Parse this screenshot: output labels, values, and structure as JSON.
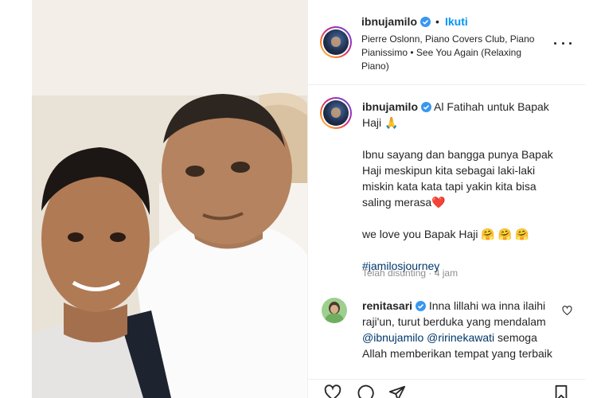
{
  "post": {
    "username": "ibnujamilo",
    "follow_label": "Ikuti",
    "separator": "•",
    "audio": "Pierre Oslonn, Piano Covers Club, Piano Pianissimo • See You Again (Relaxing Piano)",
    "caption": {
      "line1": "Al Fatihah untuk Bapak Haji 🙏",
      "line2": "Ibnu sayang dan bangga punya Bapak Haji meskipun kita sebagai laki-laki miskin kata kata tapi yakin kita bisa saling merasa❤️",
      "line3": "we love you Bapak Haji 🤗 🤗 🤗",
      "hashtag": "#jamilosjourney"
    },
    "edited_time": "Telah disunting · 4 jam"
  },
  "comment": {
    "username": "renitasari",
    "text_part1": "Inna lillahi wa inna ilaihi raji'un, turut berduka yang mendalam ",
    "mention1": "@ibnujamilo",
    "mention2": "@ririnekawati",
    "text_part2": " semoga Allah memberikan tempat yang terbaik"
  },
  "icons": {
    "verified": "verified-badge-icon",
    "more": "more-options-icon",
    "like": "heart-icon",
    "comment": "comment-icon",
    "share": "paper-plane-icon",
    "save": "bookmark-icon"
  },
  "colors": {
    "link_blue": "#0095f6",
    "hashtag_blue": "#00376b",
    "verified_blue": "#3897f0",
    "muted_gray": "#8e8e8e"
  }
}
